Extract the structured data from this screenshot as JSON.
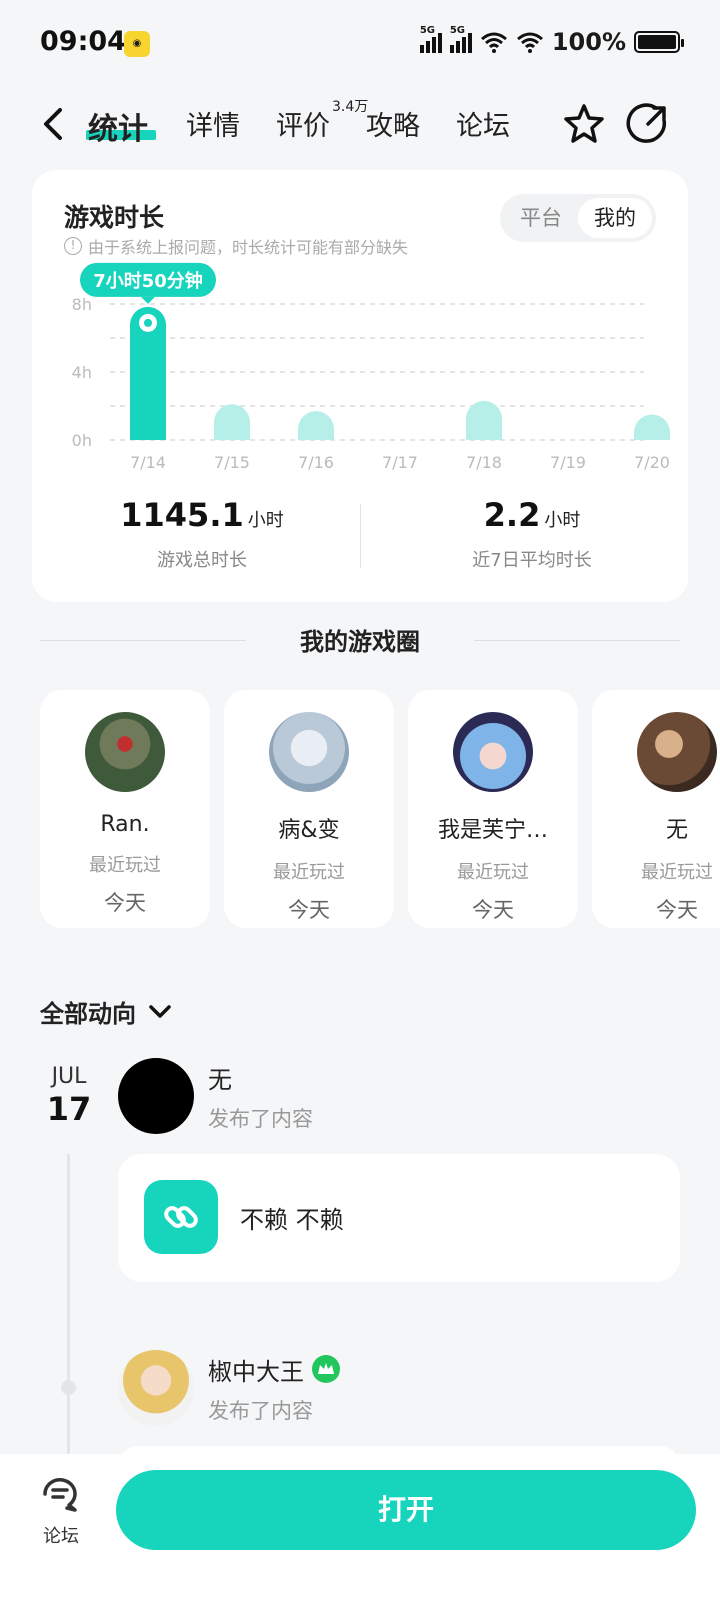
{
  "status_bar": {
    "time": "09:04",
    "app_icon": "game-app-icon",
    "signal_1_label": "5G",
    "signal_2_label": "5G",
    "battery": "100%"
  },
  "nav": {
    "tabs": [
      "统计",
      "详情",
      "评价",
      "攻略",
      "论坛"
    ],
    "active_tab": "统计",
    "review_badge": "3.4万",
    "accent_color": "#17d4bd"
  },
  "playtime": {
    "title": "游戏时长",
    "note": "由于系统上报问题，时长统计可能有部分缺失",
    "segment": [
      "平台",
      "我的"
    ],
    "segment_selected": "我的",
    "tooltip": "7小时50分钟",
    "total_value": "1145.1",
    "total_unit": "小时",
    "total_label": "游戏总时长",
    "avg_value": "2.2",
    "avg_unit": "小时",
    "avg_label": "近7日平均时长"
  },
  "chart_data": {
    "type": "bar",
    "categories": [
      "7/14",
      "7/15",
      "7/16",
      "7/17",
      "7/18",
      "7/19",
      "7/20"
    ],
    "values": [
      7.83,
      2.1,
      1.7,
      0,
      2.3,
      0,
      1.5
    ],
    "y_ticks": [
      "8h",
      "4h",
      "0h"
    ],
    "ylim": [
      0,
      8
    ],
    "highlight_index": 0,
    "grid": true,
    "bar_color": "#17d4bd",
    "bar_color_dim": "#b6efe8"
  },
  "game_circle": {
    "title": "我的游戏圈",
    "friends": [
      {
        "name": "Ran.",
        "sub": "最近玩过",
        "day": "今天"
      },
      {
        "name": "病&变",
        "sub": "最近玩过",
        "day": "今天"
      },
      {
        "name": "我是芙宁…",
        "sub": "最近玩过",
        "day": "今天"
      },
      {
        "name": "无",
        "sub": "最近玩过",
        "day": "今天"
      }
    ]
  },
  "feed": {
    "filter": "全部动向",
    "date_month": "JUL",
    "date_day": "17",
    "posts": [
      {
        "name": "无",
        "action": "发布了内容",
        "text": "不赖 不赖"
      },
      {
        "name": "椒中大王",
        "action": "发布了内容"
      }
    ]
  },
  "bottom": {
    "forum_label": "论坛",
    "open_label": "打开"
  }
}
